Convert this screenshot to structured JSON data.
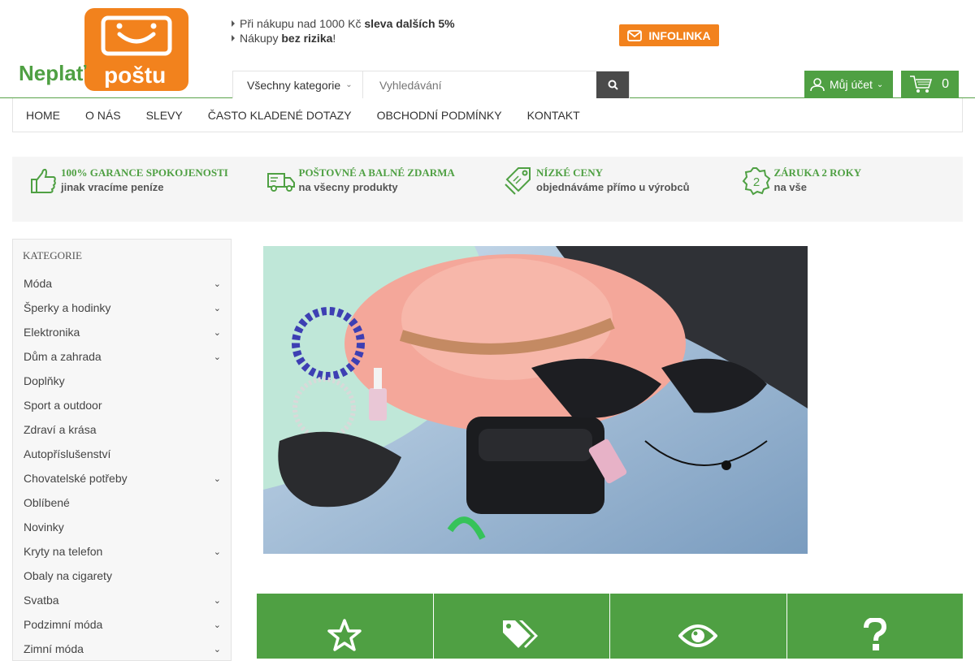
{
  "brand": {
    "name_part1": "Neplať",
    "name_part2": "poštu"
  },
  "promo": {
    "line1_prefix": "Při nákupu nad 1000 Kč ",
    "line1_bold": "sleva dalších 5%",
    "line2_prefix": "Nákupy ",
    "line2_bold": "bez rizika",
    "line2_suffix": "!"
  },
  "infolinka": {
    "label": "INFOLINKA"
  },
  "search": {
    "category": "Všechny kategorie",
    "placeholder": "Vyhledávání"
  },
  "account": {
    "label": "Můj účet"
  },
  "cart": {
    "count": "0"
  },
  "nav": [
    "HOME",
    "O NÁS",
    "SLEVY",
    "ČASTO KLADENÉ DOTAZY",
    "OBCHODNÍ PODMÍNKY",
    "KONTAKT"
  ],
  "benefits": [
    {
      "title": "100% GARANCE SPOKOJENOSTI",
      "subtitle": "jinak vracíme peníze",
      "icon": "thumbs-up-icon"
    },
    {
      "title": "POŠTOVNÉ A BALNÉ ZDARMA",
      "subtitle": "na všecny produkty",
      "icon": "truck-icon"
    },
    {
      "title": "NÍZKÉ CENY",
      "subtitle": "objednáváme přímo u výrobců",
      "icon": "price-tag-icon"
    },
    {
      "title": "ZÁRUKA 2 ROKY",
      "subtitle": "na vše",
      "icon": "badge-2-icon"
    }
  ],
  "categories": {
    "heading": "KATEGORIE",
    "items": [
      {
        "label": "Móda",
        "expand": true
      },
      {
        "label": "Šperky a hodinky",
        "expand": true
      },
      {
        "label": "Elektronika",
        "expand": true
      },
      {
        "label": "Dům a zahrada",
        "expand": true
      },
      {
        "label": "Doplňky",
        "expand": false
      },
      {
        "label": "Sport a outdoor",
        "expand": false
      },
      {
        "label": "Zdraví a krása",
        "expand": false
      },
      {
        "label": "Autopříslušenství",
        "expand": false
      },
      {
        "label": "Chovatelské potřeby",
        "expand": true
      },
      {
        "label": "Oblíbené",
        "expand": false
      },
      {
        "label": "Novinky",
        "expand": false
      },
      {
        "label": "Kryty na telefon",
        "expand": true
      },
      {
        "label": "Obaly na cigarety",
        "expand": false
      },
      {
        "label": "Svatba",
        "expand": true
      },
      {
        "label": "Podzimní móda",
        "expand": true
      },
      {
        "label": "Zimní móda",
        "expand": true
      }
    ]
  },
  "tiles": [
    "star-icon",
    "tags-icon",
    "eye-icon",
    "question-icon"
  ],
  "colors": {
    "green": "#4fa043",
    "orange": "#f2821d",
    "dark": "#4a4a4a"
  }
}
